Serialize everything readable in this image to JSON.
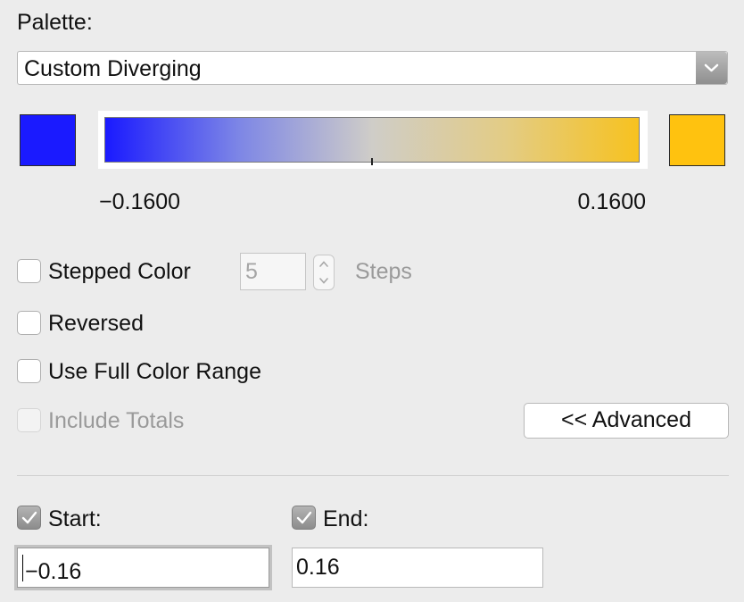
{
  "palette": {
    "label": "Palette:",
    "selected": "Custom Diverging"
  },
  "colors": {
    "start_color": "#1a1aff",
    "end_color": "#ffc20f",
    "gradient": [
      "#1a1aff",
      "#7d86e6",
      "#cfcdc8",
      "#e3cc85",
      "#f7c21f"
    ]
  },
  "range_labels": {
    "min": "−0.1600",
    "max": "0.1600"
  },
  "stepped": {
    "label": "Stepped Color",
    "checked": false,
    "value": "5",
    "steps_label": "Steps"
  },
  "reversed": {
    "label": "Reversed",
    "checked": false
  },
  "full_range": {
    "label": "Use Full Color Range",
    "checked": false
  },
  "include_totals": {
    "label": "Include Totals",
    "checked": false,
    "enabled": false
  },
  "advanced_button": "<< Advanced",
  "start": {
    "label": "Start:",
    "checked": true,
    "value": "−0.16"
  },
  "end": {
    "label": "End:",
    "checked": true,
    "value": "0.16"
  }
}
